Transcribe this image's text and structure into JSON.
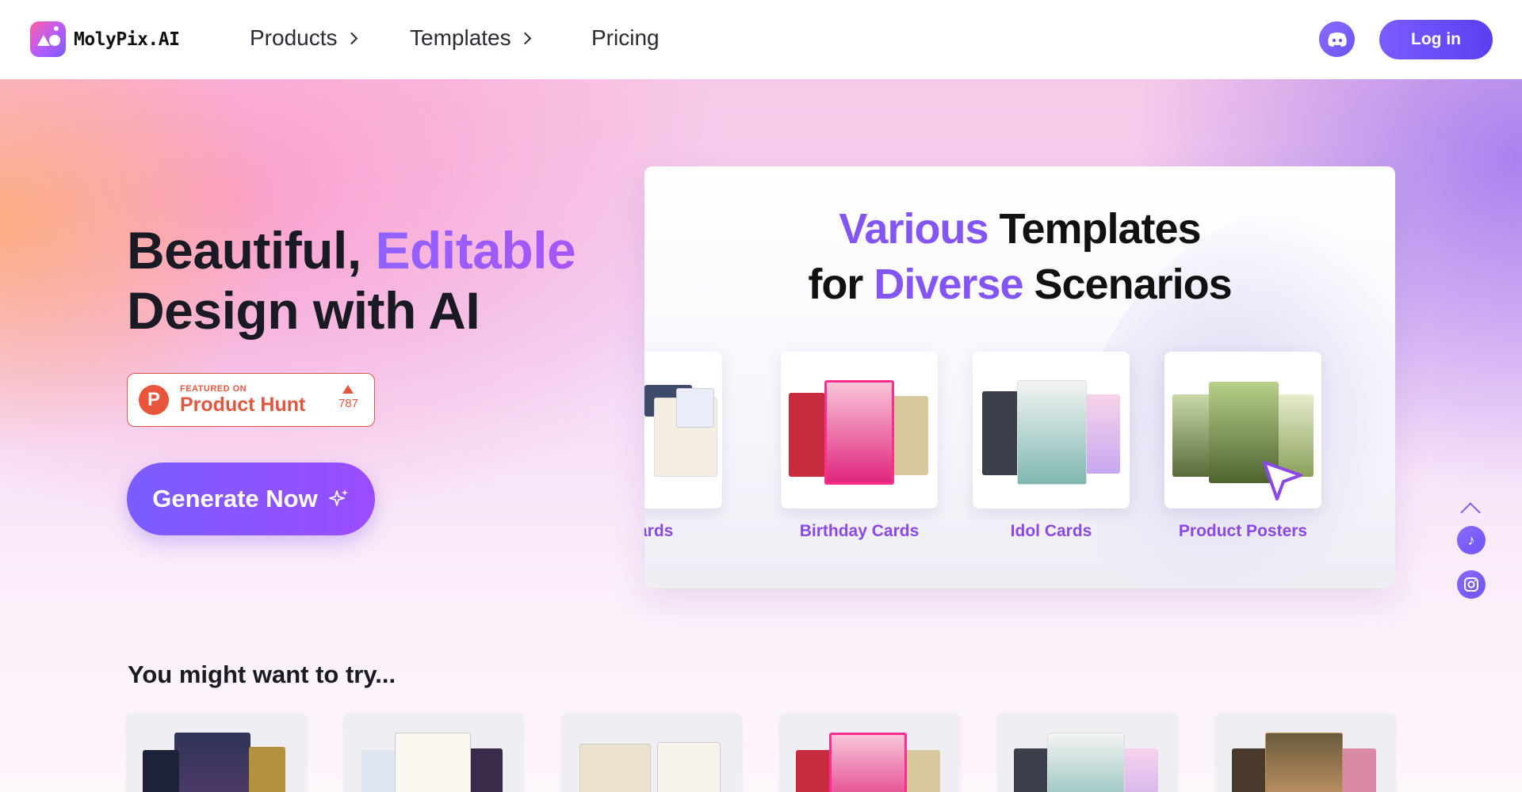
{
  "nav": {
    "brand": "MolyPix.AI",
    "products": "Products",
    "templates": "Templates",
    "pricing": "Pricing",
    "login": "Log in"
  },
  "hero": {
    "title_line1_a": "Beautiful, ",
    "title_line1_b": "Editable",
    "title_line2": "Design with AI",
    "producthunt": {
      "featured": "FEATURED ON",
      "name": "Product Hunt",
      "votes": "787"
    },
    "cta": "Generate Now"
  },
  "showcase": {
    "title_a1": "Various",
    "title_a2": " Templates",
    "title_b1": "for ",
    "title_b2": "Diverse",
    "title_b3": " Scenarios",
    "cards": [
      {
        "label": "stcards"
      },
      {
        "label": "Birthday Cards"
      },
      {
        "label": "Idol Cards"
      },
      {
        "label": "Product Posters"
      }
    ]
  },
  "try": {
    "title": "You might want to try..."
  },
  "colors": {
    "accent": "#7b5cff",
    "producthunt": "#e0573f"
  }
}
